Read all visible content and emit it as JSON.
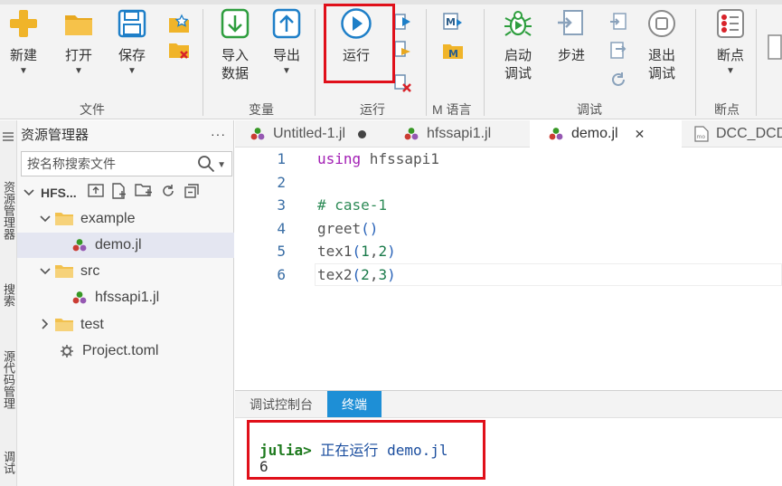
{
  "ribbon": {
    "file": {
      "group": "文件",
      "new": "新建",
      "open": "打开",
      "save": "保存"
    },
    "variables": {
      "group": "变量",
      "import_line1": "导入",
      "import_line2": "数据",
      "export": "导出"
    },
    "run": {
      "group": "运行",
      "run": "运行"
    },
    "mlang": {
      "group": "M 语言"
    },
    "debug": {
      "group": "调试",
      "start_line1": "启动",
      "start_line2": "调试",
      "step": "步进",
      "stop_line1": "退出",
      "stop_line2": "调试"
    },
    "breakpoint": {
      "group": "断点",
      "breakpoint": "断点"
    }
  },
  "activity_bar": {
    "explorer": "资源管理器",
    "search": "搜索",
    "scm": "源代码管理",
    "debug": "调试"
  },
  "explorer": {
    "title": "资源管理器",
    "more": "···",
    "search_placeholder": "按名称搜索文件",
    "project": "HFS...",
    "tree": [
      {
        "name": "example",
        "type": "folder",
        "expanded": true
      },
      {
        "name": "demo.jl",
        "type": "julia-file",
        "selected": true
      },
      {
        "name": "src",
        "type": "folder",
        "expanded": true
      },
      {
        "name": "hfssapi1.jl",
        "type": "julia-file"
      },
      {
        "name": "test",
        "type": "folder",
        "expanded": false
      },
      {
        "name": "Project.toml",
        "type": "toml-file"
      }
    ]
  },
  "tabs": [
    {
      "label": "Untitled-1.jl",
      "state": "modified"
    },
    {
      "label": "hfssapi1.jl"
    },
    {
      "label": "demo.jl",
      "active": true
    },
    {
      "label": "DCC_DCD"
    }
  ],
  "editor": {
    "lines": [
      {
        "n": "1",
        "tokens": [
          {
            "t": "using",
            "c": "kw"
          },
          {
            "t": " hfssapi1",
            "c": ""
          }
        ]
      },
      {
        "n": "2",
        "tokens": []
      },
      {
        "n": "3",
        "tokens": [
          {
            "t": "# case-1",
            "c": "com"
          }
        ]
      },
      {
        "n": "4",
        "tokens": [
          {
            "t": "greet",
            "c": ""
          },
          {
            "t": "()",
            "c": "fn"
          }
        ]
      },
      {
        "n": "5",
        "tokens": [
          {
            "t": "tex1",
            "c": ""
          },
          {
            "t": "(",
            "c": "fn"
          },
          {
            "t": "1",
            "c": "num"
          },
          {
            "t": ",",
            "c": ""
          },
          {
            "t": "2",
            "c": "num"
          },
          {
            "t": ")",
            "c": "fn"
          }
        ]
      },
      {
        "n": "6",
        "tokens": [
          {
            "t": "tex2",
            "c": ""
          },
          {
            "t": "(",
            "c": "fn"
          },
          {
            "t": "2",
            "c": "num"
          },
          {
            "t": ",",
            "c": ""
          },
          {
            "t": "3",
            "c": "num"
          },
          {
            "t": ")",
            "c": "fn"
          }
        ]
      }
    ]
  },
  "panel": {
    "tabs": [
      {
        "label": "调试控制台"
      },
      {
        "label": "终端",
        "active": true
      }
    ],
    "terminal": {
      "prompt": "julia>",
      "command": " 正在运行 demo.jl",
      "output": "6"
    }
  },
  "colors": {
    "accent": "#1e8fd6",
    "highlight_box": "#e0101a",
    "keyword": "#a21eb4",
    "comment": "#2e8b57"
  }
}
